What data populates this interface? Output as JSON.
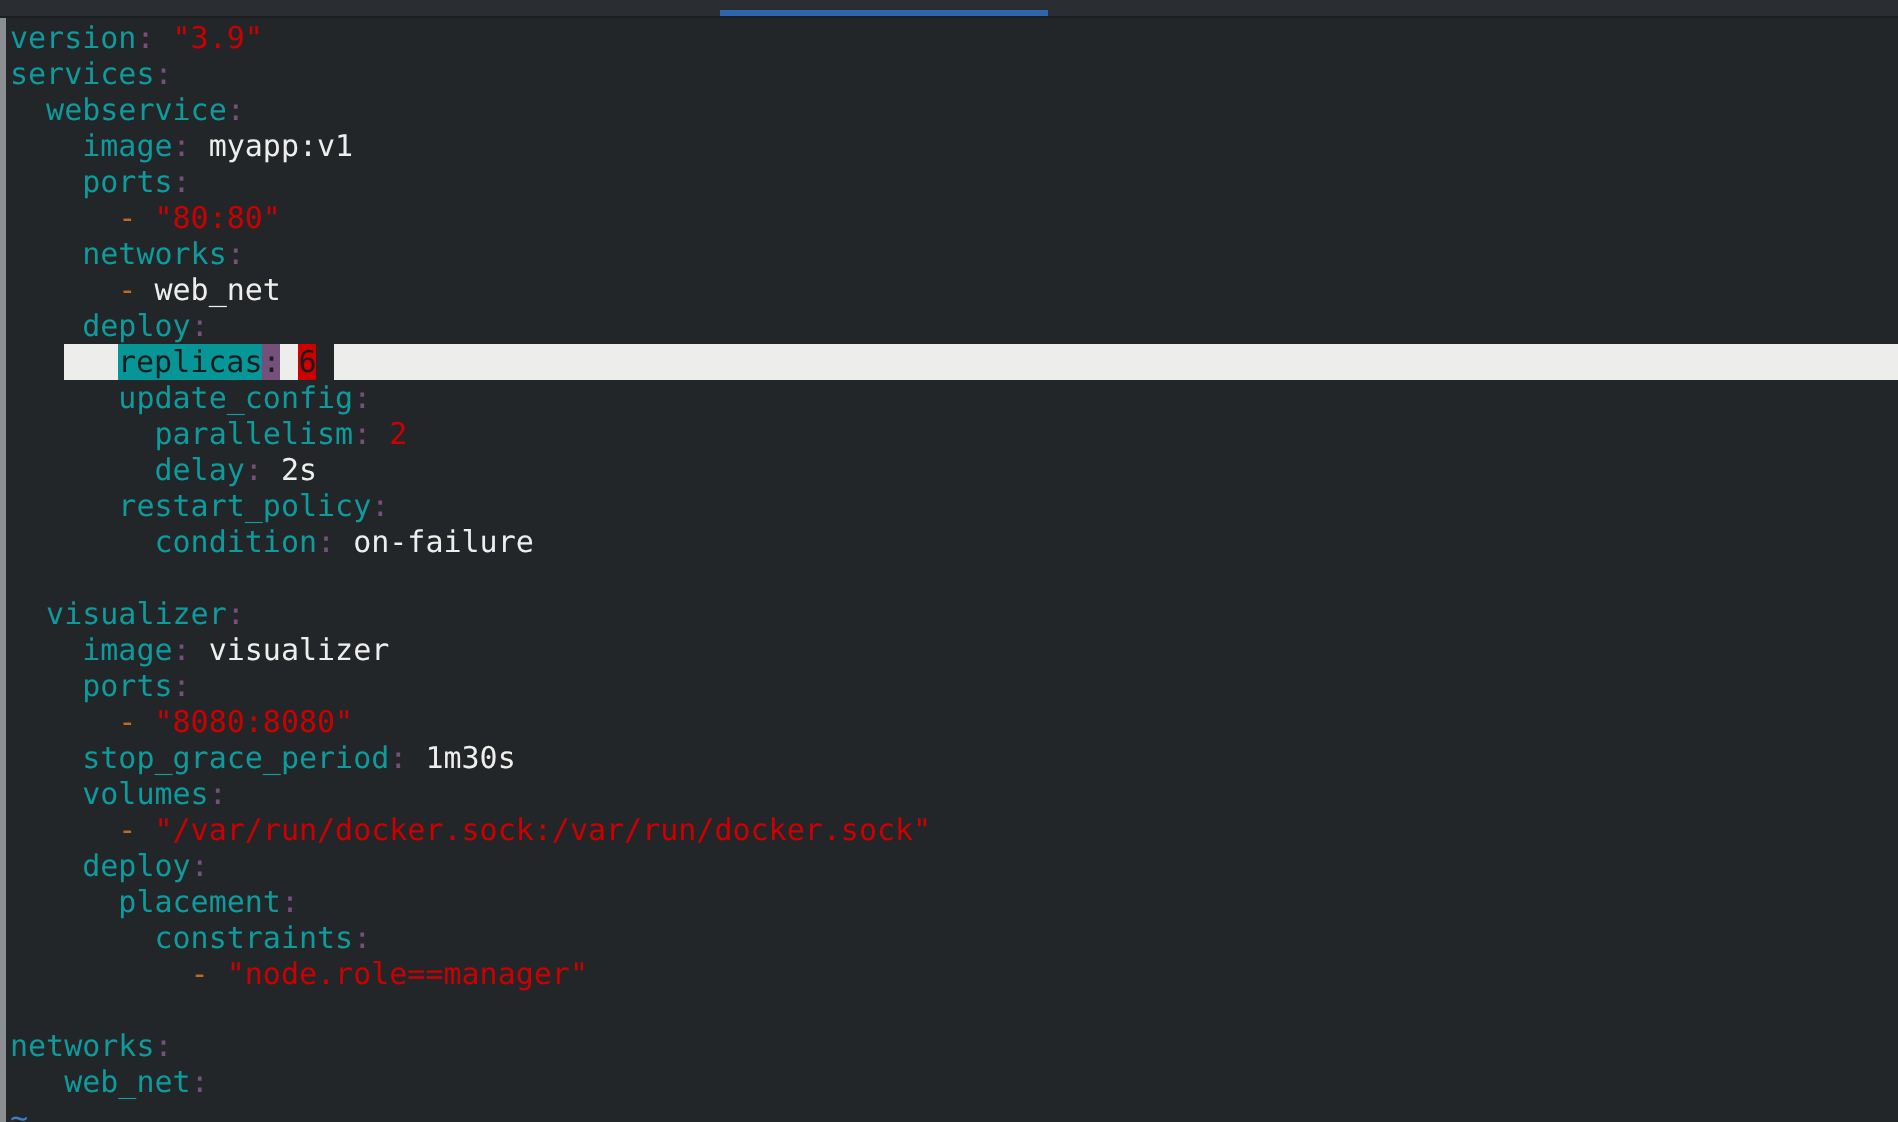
{
  "lines": [
    {
      "kind": "code",
      "cursor": false,
      "tokens": [
        {
          "kind": "key",
          "t": "version"
        },
        {
          "kind": "colon",
          "t": ":"
        },
        {
          "kind": "string",
          "t": " \"3.9\""
        }
      ]
    },
    {
      "kind": "code",
      "cursor": false,
      "tokens": [
        {
          "kind": "key",
          "t": "services"
        },
        {
          "kind": "colon",
          "t": ":"
        }
      ]
    },
    {
      "kind": "code",
      "cursor": false,
      "tokens": [
        {
          "kind": "key",
          "t": "  webservice"
        },
        {
          "kind": "colon",
          "t": ":"
        }
      ]
    },
    {
      "kind": "code",
      "cursor": false,
      "tokens": [
        {
          "kind": "key",
          "t": "    image"
        },
        {
          "kind": "colon",
          "t": ":"
        },
        {
          "kind": "plain",
          "t": " myapp:v1"
        }
      ]
    },
    {
      "kind": "code",
      "cursor": false,
      "tokens": [
        {
          "kind": "key",
          "t": "    ports"
        },
        {
          "kind": "colon",
          "t": ":"
        }
      ]
    },
    {
      "kind": "code",
      "cursor": false,
      "tokens": [
        {
          "kind": "dash",
          "t": "      -"
        },
        {
          "kind": "string",
          "t": " \"80:80\""
        }
      ]
    },
    {
      "kind": "code",
      "cursor": false,
      "tokens": [
        {
          "kind": "key",
          "t": "    networks"
        },
        {
          "kind": "colon",
          "t": ":"
        }
      ]
    },
    {
      "kind": "code",
      "cursor": false,
      "tokens": [
        {
          "kind": "dash",
          "t": "      -"
        },
        {
          "kind": "plain",
          "t": " web_net"
        }
      ]
    },
    {
      "kind": "code",
      "cursor": false,
      "tokens": [
        {
          "kind": "key",
          "t": "    deploy"
        },
        {
          "kind": "colon",
          "t": ":"
        }
      ]
    },
    {
      "kind": "code",
      "cursor": true,
      "tokens": [
        {
          "kind": "key",
          "t": "replicas"
        },
        {
          "kind": "colon",
          "t": ":"
        },
        {
          "kind": "number",
          "t": "6"
        }
      ]
    },
    {
      "kind": "code",
      "cursor": false,
      "tokens": [
        {
          "kind": "key",
          "t": "      update_config"
        },
        {
          "kind": "colon",
          "t": ":"
        }
      ]
    },
    {
      "kind": "code",
      "cursor": false,
      "tokens": [
        {
          "kind": "key",
          "t": "        parallelism"
        },
        {
          "kind": "colon",
          "t": ":"
        },
        {
          "kind": "number",
          "t": " 2"
        }
      ]
    },
    {
      "kind": "code",
      "cursor": false,
      "tokens": [
        {
          "kind": "key",
          "t": "        delay"
        },
        {
          "kind": "colon",
          "t": ":"
        },
        {
          "kind": "plain",
          "t": " 2s"
        }
      ]
    },
    {
      "kind": "code",
      "cursor": false,
      "tokens": [
        {
          "kind": "key",
          "t": "      restart_policy"
        },
        {
          "kind": "colon",
          "t": ":"
        }
      ]
    },
    {
      "kind": "code",
      "cursor": false,
      "tokens": [
        {
          "kind": "key",
          "t": "        condition"
        },
        {
          "kind": "colon",
          "t": ":"
        },
        {
          "kind": "plain",
          "t": " on-failure"
        }
      ]
    },
    {
      "kind": "blank",
      "cursor": false
    },
    {
      "kind": "code",
      "cursor": false,
      "tokens": [
        {
          "kind": "key",
          "t": "  visualizer"
        },
        {
          "kind": "colon",
          "t": ":"
        }
      ]
    },
    {
      "kind": "code",
      "cursor": false,
      "tokens": [
        {
          "kind": "key",
          "t": "    image"
        },
        {
          "kind": "colon",
          "t": ":"
        },
        {
          "kind": "plain",
          "t": " visualizer"
        }
      ]
    },
    {
      "kind": "code",
      "cursor": false,
      "tokens": [
        {
          "kind": "key",
          "t": "    ports"
        },
        {
          "kind": "colon",
          "t": ":"
        }
      ]
    },
    {
      "kind": "code",
      "cursor": false,
      "tokens": [
        {
          "kind": "dash",
          "t": "      -"
        },
        {
          "kind": "string",
          "t": " \"8080:8080\""
        }
      ]
    },
    {
      "kind": "code",
      "cursor": false,
      "tokens": [
        {
          "kind": "key",
          "t": "    stop_grace_period"
        },
        {
          "kind": "colon",
          "t": ":"
        },
        {
          "kind": "plain",
          "t": " 1m30s"
        }
      ]
    },
    {
      "kind": "code",
      "cursor": false,
      "tokens": [
        {
          "kind": "key",
          "t": "    volumes"
        },
        {
          "kind": "colon",
          "t": ":"
        }
      ]
    },
    {
      "kind": "code",
      "cursor": false,
      "tokens": [
        {
          "kind": "dash",
          "t": "      -"
        },
        {
          "kind": "string",
          "t": " \"/var/run/docker.sock:/var/run/docker.sock\""
        }
      ]
    },
    {
      "kind": "code",
      "cursor": false,
      "tokens": [
        {
          "kind": "key",
          "t": "    deploy"
        },
        {
          "kind": "colon",
          "t": ":"
        }
      ]
    },
    {
      "kind": "code",
      "cursor": false,
      "tokens": [
        {
          "kind": "key",
          "t": "      placement"
        },
        {
          "kind": "colon",
          "t": ":"
        }
      ]
    },
    {
      "kind": "code",
      "cursor": false,
      "tokens": [
        {
          "kind": "key",
          "t": "        constraints"
        },
        {
          "kind": "colon",
          "t": ":"
        }
      ]
    },
    {
      "kind": "code",
      "cursor": false,
      "tokens": [
        {
          "kind": "dash",
          "t": "          -"
        },
        {
          "kind": "string",
          "t": " \"node.role==manager\""
        }
      ]
    },
    {
      "kind": "blank",
      "cursor": false
    },
    {
      "kind": "code",
      "cursor": false,
      "tokens": [
        {
          "kind": "key",
          "t": "networks"
        },
        {
          "kind": "colon",
          "t": ":"
        }
      ]
    },
    {
      "kind": "code",
      "cursor": false,
      "tokens": [
        {
          "kind": "key",
          "t": "   web_net"
        },
        {
          "kind": "colon",
          "t": ":"
        }
      ]
    },
    {
      "kind": "tilde",
      "cursor": false,
      "tokens": [
        {
          "kind": "tilde",
          "t": "~"
        }
      ]
    }
  ]
}
